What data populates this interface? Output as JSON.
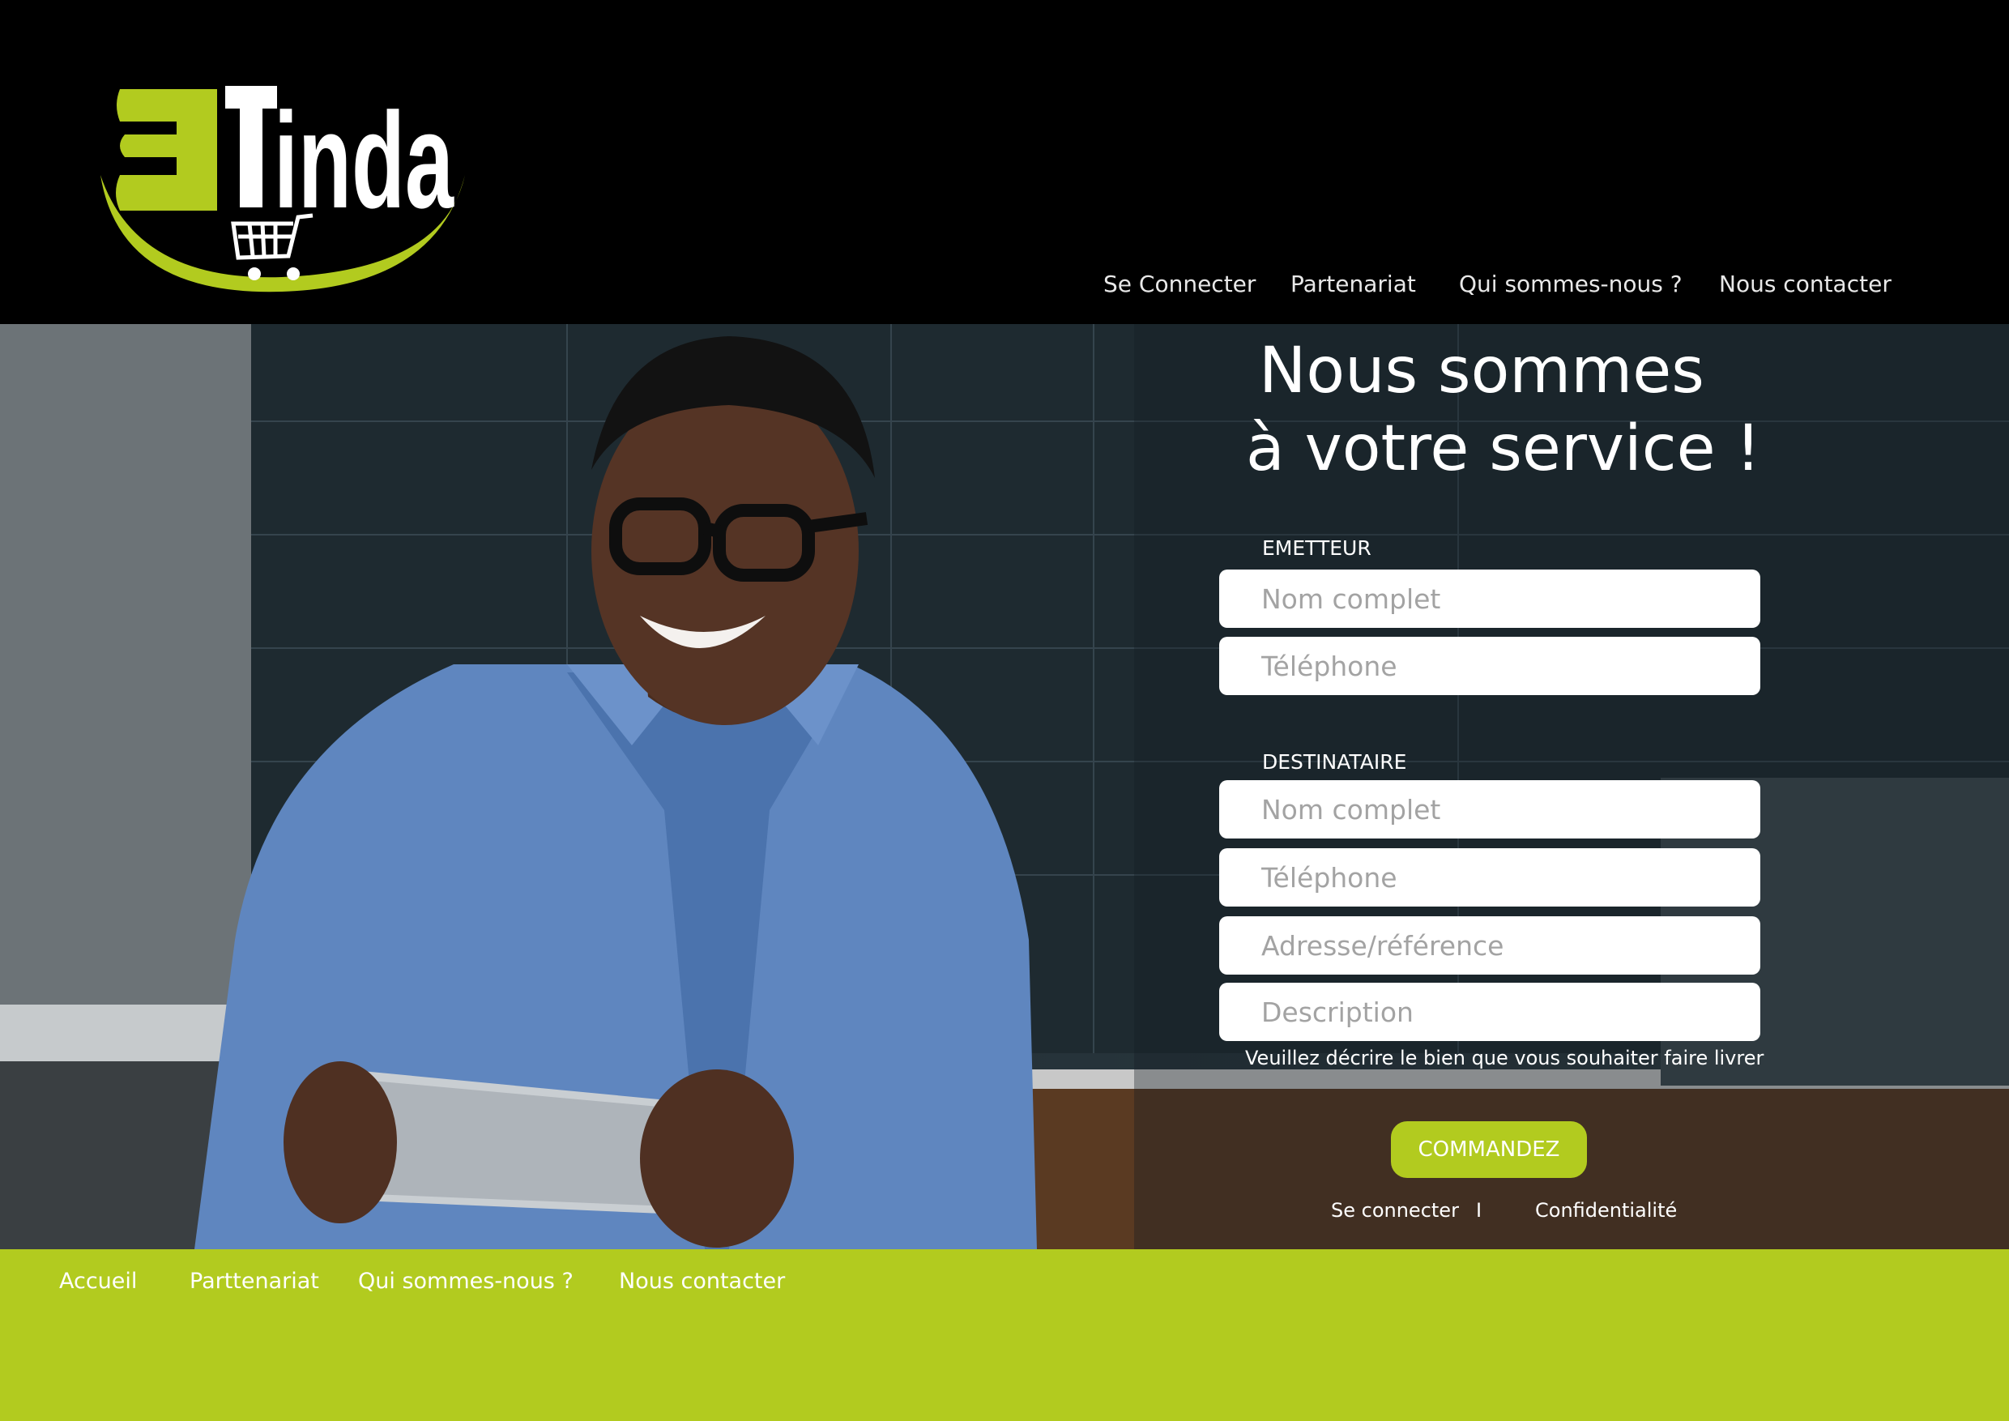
{
  "brand": {
    "logo_text": "BTinda",
    "accent_color": "#b2cb1f",
    "header_bg": "#000000"
  },
  "nav": {
    "items": [
      {
        "label": "Se Connecter"
      },
      {
        "label": "Partenariat"
      },
      {
        "label": "Qui sommes-nous ?"
      },
      {
        "label": "Nous contacter"
      }
    ]
  },
  "hero": {
    "title_line1": "Nous sommes",
    "title_line2": "à votre service !",
    "image": "smiling man in blue shirt holding a tablet in an office"
  },
  "form": {
    "sender": {
      "label": "EMETTEUR",
      "name_placeholder": "Nom complet",
      "phone_placeholder": "Téléphone"
    },
    "recipient": {
      "label": "DESTINATAIRE",
      "name_placeholder": "Nom complet",
      "phone_placeholder": "Téléphone",
      "address_placeholder": "Adresse/référence",
      "description_placeholder": "Description"
    },
    "hint": "Veuillez décrire le bien que vous souhaiter faire livrer",
    "submit_label": "COMMANDEZ",
    "login_link": "Se connecter",
    "separator": "I",
    "privacy_link": "Confidentialité"
  },
  "footer": {
    "links": [
      {
        "label": "Accueil"
      },
      {
        "label": "Parttenariat"
      },
      {
        "label": "Qui sommes-nous ?"
      },
      {
        "label": "Nous contacter"
      }
    ]
  }
}
